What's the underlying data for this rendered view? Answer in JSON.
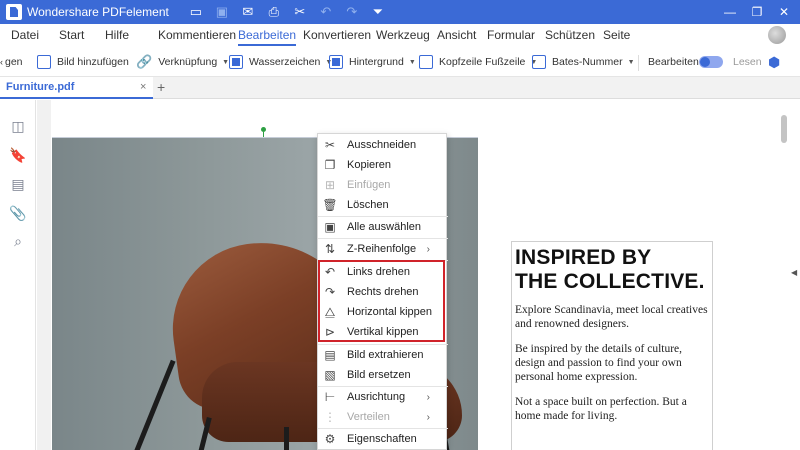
{
  "titlebar": {
    "app_title": "Wondershare PDFelement",
    "icons": [
      "folder-icon",
      "save-icon",
      "mail-icon",
      "print-icon",
      "scissors-icon",
      "undo-icon",
      "redo-icon",
      "quick-access-dropdown-icon"
    ],
    "controls": [
      "minimize-icon",
      "restore-icon",
      "close-icon"
    ]
  },
  "menubar": {
    "items": [
      "Datei",
      "Start",
      "Hilfe",
      "Kommentieren",
      "Bearbeiten",
      "Konvertieren",
      "Werkzeug",
      "Ansicht",
      "Formular",
      "Schützen",
      "Seite"
    ],
    "active": "Bearbeiten"
  },
  "toolbar": {
    "partial_label": "gen",
    "tools": [
      {
        "label": "Bild hinzufügen",
        "icon": "image-add-icon"
      },
      {
        "label": "Verknüpfung",
        "icon": "link-icon"
      },
      {
        "label": "Wasserzeichen",
        "icon": "watermark-icon"
      },
      {
        "label": "Hintergrund",
        "icon": "background-icon"
      },
      {
        "label": "Kopfzeile Fußzeile",
        "icon": "header-footer-icon"
      },
      {
        "label": "Bates-Nummer",
        "icon": "bates-number-icon"
      }
    ],
    "mode_edit": "Bearbeiten",
    "mode_read": "Lesen"
  },
  "tabs": {
    "doc_tab": "Furniture.pdf",
    "close_glyph": "×",
    "add_glyph": "+"
  },
  "leftpanel": {
    "icons": [
      "thumbnails-icon",
      "bookmark-icon",
      "comment-icon",
      "attachment-icon",
      "search-icon"
    ]
  },
  "context_menu": {
    "items": [
      {
        "label": "Ausschneiden",
        "icon": "scissors-icon",
        "glyph": "✂",
        "enabled": true,
        "submenu": false
      },
      {
        "label": "Kopieren",
        "icon": "copy-icon",
        "glyph": "❐",
        "enabled": true,
        "submenu": false
      },
      {
        "label": "Einfügen",
        "icon": "paste-icon",
        "glyph": "⊞",
        "enabled": false,
        "submenu": false
      },
      {
        "label": "Löschen",
        "icon": "trash-icon",
        "glyph": "🗑",
        "enabled": true,
        "submenu": false
      },
      {
        "label": "Alle auswählen",
        "icon": "select-all-icon",
        "glyph": "▣",
        "enabled": true,
        "submenu": false
      },
      {
        "label": "Z-Reihenfolge",
        "icon": "z-order-icon",
        "glyph": "⇅",
        "enabled": true,
        "submenu": true
      },
      {
        "label": "Links drehen",
        "icon": "rotate-left-icon",
        "glyph": "↶",
        "enabled": true,
        "submenu": false
      },
      {
        "label": "Rechts drehen",
        "icon": "rotate-right-icon",
        "glyph": "↷",
        "enabled": true,
        "submenu": false
      },
      {
        "label": "Horizontal kippen",
        "icon": "flip-horizontal-icon",
        "glyph": "⧋",
        "enabled": true,
        "submenu": false
      },
      {
        "label": "Vertikal kippen",
        "icon": "flip-vertical-icon",
        "glyph": "⊳",
        "enabled": true,
        "submenu": false
      },
      {
        "label": "Bild extrahieren",
        "icon": "extract-image-icon",
        "glyph": "▤",
        "enabled": true,
        "submenu": false
      },
      {
        "label": "Bild ersetzen",
        "icon": "replace-image-icon",
        "glyph": "▧",
        "enabled": true,
        "submenu": false
      },
      {
        "label": "Ausrichtung",
        "icon": "align-icon",
        "glyph": "⊢",
        "enabled": true,
        "submenu": true
      },
      {
        "label": "Verteilen",
        "icon": "distribute-icon",
        "glyph": "⋮",
        "enabled": false,
        "submenu": true
      },
      {
        "label": "Eigenschaften",
        "icon": "gear-icon",
        "glyph": "⚙",
        "enabled": true,
        "submenu": false
      }
    ],
    "submenu_glyph": "›"
  },
  "page": {
    "heading_line1": "INSPIRED BY",
    "heading_line2": "THE COLLECTIVE.",
    "para1": "Explore Scandinavia, meet local creatives and renowned designers.",
    "para2": "Be inspired by the details of culture, design and passion to find your own personal home expression.",
    "para3": "Not a space built on perfection. But a home made for living."
  },
  "colors": {
    "brand": "#3b6ad6",
    "highlight": "#d0232a"
  }
}
